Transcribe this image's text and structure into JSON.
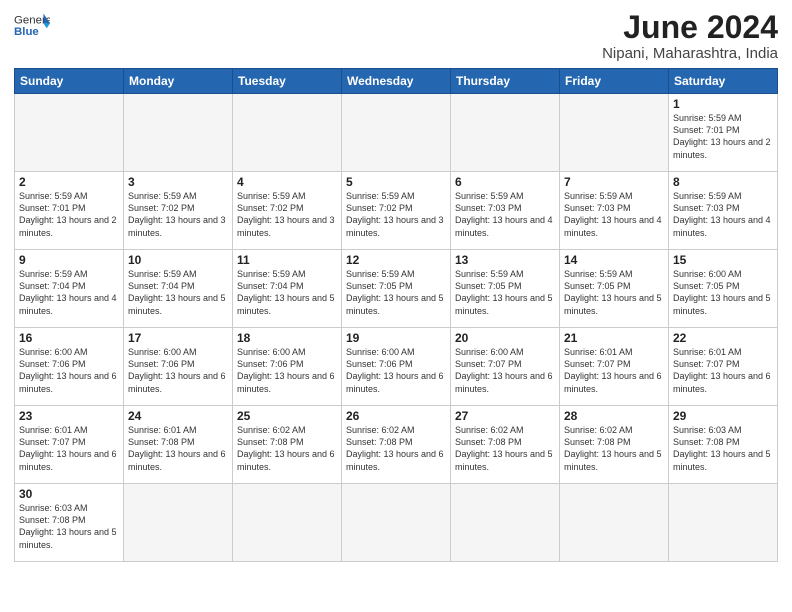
{
  "logo": {
    "text_general": "General",
    "text_blue": "Blue"
  },
  "title": "June 2024",
  "location": "Nipani, Maharashtra, India",
  "weekdays": [
    "Sunday",
    "Monday",
    "Tuesday",
    "Wednesday",
    "Thursday",
    "Friday",
    "Saturday"
  ],
  "weeks": [
    [
      {
        "day": "",
        "info": ""
      },
      {
        "day": "",
        "info": ""
      },
      {
        "day": "",
        "info": ""
      },
      {
        "day": "",
        "info": ""
      },
      {
        "day": "",
        "info": ""
      },
      {
        "day": "",
        "info": ""
      },
      {
        "day": "1",
        "info": "Sunrise: 5:59 AM\nSunset: 7:01 PM\nDaylight: 13 hours and 2 minutes."
      }
    ],
    [
      {
        "day": "2",
        "info": "Sunrise: 5:59 AM\nSunset: 7:01 PM\nDaylight: 13 hours and 2 minutes."
      },
      {
        "day": "3",
        "info": "Sunrise: 5:59 AM\nSunset: 7:02 PM\nDaylight: 13 hours and 3 minutes."
      },
      {
        "day": "4",
        "info": "Sunrise: 5:59 AM\nSunset: 7:02 PM\nDaylight: 13 hours and 3 minutes."
      },
      {
        "day": "5",
        "info": "Sunrise: 5:59 AM\nSunset: 7:02 PM\nDaylight: 13 hours and 3 minutes."
      },
      {
        "day": "6",
        "info": "Sunrise: 5:59 AM\nSunset: 7:03 PM\nDaylight: 13 hours and 4 minutes."
      },
      {
        "day": "7",
        "info": "Sunrise: 5:59 AM\nSunset: 7:03 PM\nDaylight: 13 hours and 4 minutes."
      },
      {
        "day": "8",
        "info": "Sunrise: 5:59 AM\nSunset: 7:03 PM\nDaylight: 13 hours and 4 minutes."
      }
    ],
    [
      {
        "day": "9",
        "info": "Sunrise: 5:59 AM\nSunset: 7:04 PM\nDaylight: 13 hours and 4 minutes."
      },
      {
        "day": "10",
        "info": "Sunrise: 5:59 AM\nSunset: 7:04 PM\nDaylight: 13 hours and 5 minutes."
      },
      {
        "day": "11",
        "info": "Sunrise: 5:59 AM\nSunset: 7:04 PM\nDaylight: 13 hours and 5 minutes."
      },
      {
        "day": "12",
        "info": "Sunrise: 5:59 AM\nSunset: 7:05 PM\nDaylight: 13 hours and 5 minutes."
      },
      {
        "day": "13",
        "info": "Sunrise: 5:59 AM\nSunset: 7:05 PM\nDaylight: 13 hours and 5 minutes."
      },
      {
        "day": "14",
        "info": "Sunrise: 5:59 AM\nSunset: 7:05 PM\nDaylight: 13 hours and 5 minutes."
      },
      {
        "day": "15",
        "info": "Sunrise: 6:00 AM\nSunset: 7:05 PM\nDaylight: 13 hours and 5 minutes."
      }
    ],
    [
      {
        "day": "16",
        "info": "Sunrise: 6:00 AM\nSunset: 7:06 PM\nDaylight: 13 hours and 6 minutes."
      },
      {
        "day": "17",
        "info": "Sunrise: 6:00 AM\nSunset: 7:06 PM\nDaylight: 13 hours and 6 minutes."
      },
      {
        "day": "18",
        "info": "Sunrise: 6:00 AM\nSunset: 7:06 PM\nDaylight: 13 hours and 6 minutes."
      },
      {
        "day": "19",
        "info": "Sunrise: 6:00 AM\nSunset: 7:06 PM\nDaylight: 13 hours and 6 minutes."
      },
      {
        "day": "20",
        "info": "Sunrise: 6:00 AM\nSunset: 7:07 PM\nDaylight: 13 hours and 6 minutes."
      },
      {
        "day": "21",
        "info": "Sunrise: 6:01 AM\nSunset: 7:07 PM\nDaylight: 13 hours and 6 minutes."
      },
      {
        "day": "22",
        "info": "Sunrise: 6:01 AM\nSunset: 7:07 PM\nDaylight: 13 hours and 6 minutes."
      }
    ],
    [
      {
        "day": "23",
        "info": "Sunrise: 6:01 AM\nSunset: 7:07 PM\nDaylight: 13 hours and 6 minutes."
      },
      {
        "day": "24",
        "info": "Sunrise: 6:01 AM\nSunset: 7:08 PM\nDaylight: 13 hours and 6 minutes."
      },
      {
        "day": "25",
        "info": "Sunrise: 6:02 AM\nSunset: 7:08 PM\nDaylight: 13 hours and 6 minutes."
      },
      {
        "day": "26",
        "info": "Sunrise: 6:02 AM\nSunset: 7:08 PM\nDaylight: 13 hours and 6 minutes."
      },
      {
        "day": "27",
        "info": "Sunrise: 6:02 AM\nSunset: 7:08 PM\nDaylight: 13 hours and 5 minutes."
      },
      {
        "day": "28",
        "info": "Sunrise: 6:02 AM\nSunset: 7:08 PM\nDaylight: 13 hours and 5 minutes."
      },
      {
        "day": "29",
        "info": "Sunrise: 6:03 AM\nSunset: 7:08 PM\nDaylight: 13 hours and 5 minutes."
      }
    ],
    [
      {
        "day": "30",
        "info": "Sunrise: 6:03 AM\nSunset: 7:08 PM\nDaylight: 13 hours and 5 minutes."
      },
      {
        "day": "",
        "info": ""
      },
      {
        "day": "",
        "info": ""
      },
      {
        "day": "",
        "info": ""
      },
      {
        "day": "",
        "info": ""
      },
      {
        "day": "",
        "info": ""
      },
      {
        "day": "",
        "info": ""
      }
    ]
  ]
}
